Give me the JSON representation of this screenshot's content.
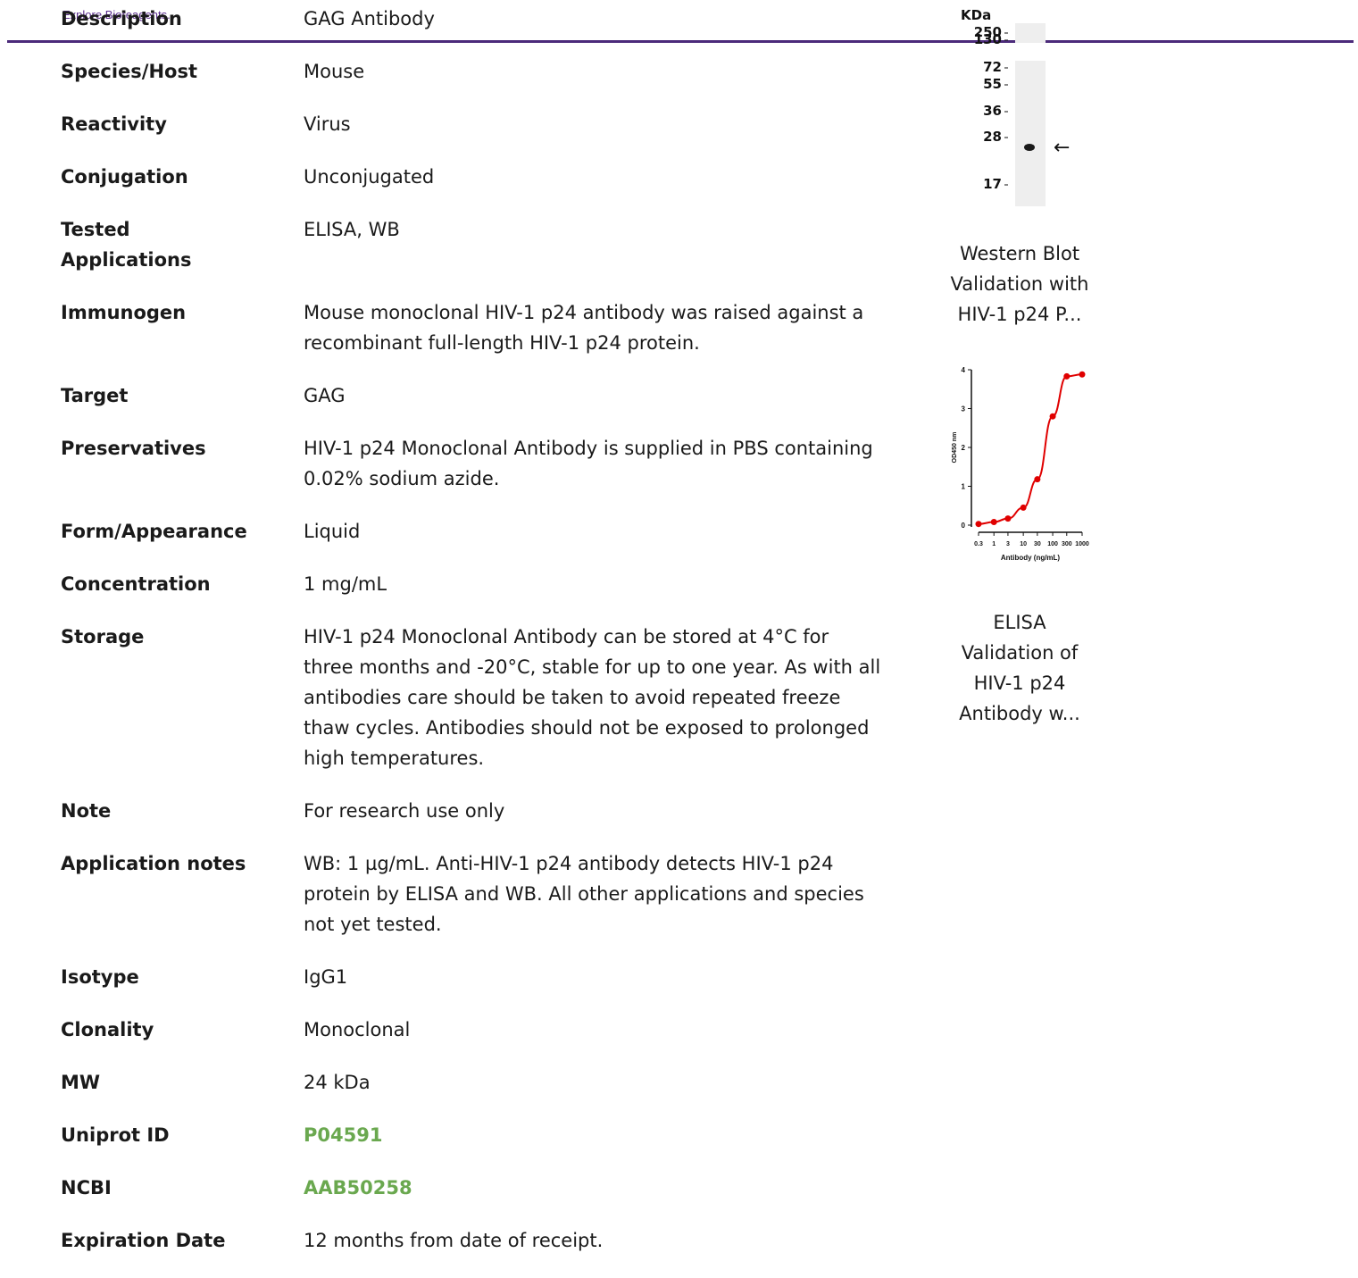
{
  "brand": {
    "text": "Explore Bioreagents.",
    "color": "#5b2d8e"
  },
  "spec": {
    "rows": [
      {
        "label": "Description",
        "value": "GAG Antibody"
      },
      {
        "label": "Species/Host",
        "value": "Mouse"
      },
      {
        "label": "Reactivity",
        "value": "Virus"
      },
      {
        "label": "Conjugation",
        "value": "Unconjugated"
      },
      {
        "label": "Tested Applications",
        "value": "ELISA, WB"
      },
      {
        "label": "Immunogen",
        "value": "Mouse monoclonal HIV-1 p24 antibody was raised against a recombinant full-length HIV-1 p24 protein."
      },
      {
        "label": "Target",
        "value": "GAG"
      },
      {
        "label": "Preservatives",
        "value": "HIV-1 p24 Monoclonal Antibody is supplied in PBS containing 0.02% sodium azide."
      },
      {
        "label": "Form/Appearance",
        "value": "Liquid"
      },
      {
        "label": "Concentration",
        "value": "1 mg/mL"
      },
      {
        "label": "Storage",
        "value": "HIV-1 p24 Monoclonal Antibody can be stored at 4°C for three months and -20°C, stable for up to one year. As with all antibodies care should be taken to avoid repeated freeze thaw cycles. Antibodies should not be exposed to prolonged high temperatures."
      },
      {
        "label": "Note",
        "value": "For research use only"
      },
      {
        "label": "Application notes",
        "value": "WB: 1 µg/mL. Anti-HIV-1 p24 antibody detects HIV-1 p24 protein by ELISA and WB. All other applications and species not yet tested."
      },
      {
        "label": "Isotype",
        "value": "IgG1"
      },
      {
        "label": "Clonality",
        "value": "Monoclonal"
      },
      {
        "label": "MW",
        "value": "24 kDa"
      },
      {
        "label": "Uniprot ID",
        "value": "P04591"
      },
      {
        "label": "NCBI",
        "value": "AAB50258"
      },
      {
        "label": "Expiration Date",
        "value": "12 months from date of receipt."
      }
    ],
    "link_color": "#6aa84f"
  },
  "gallery": {
    "western_blot": {
      "kda_label": "KDa",
      "markers": [
        "250",
        "130",
        "72",
        "55",
        "36",
        "28",
        "17"
      ],
      "arrow": "←",
      "caption": "Western Blot Validation with HIV-1 p24 P..."
    },
    "elisa": {
      "caption": "ELISA Validation of HIV-1 p24 Antibody w..."
    }
  },
  "chart_data": {
    "type": "line",
    "xlabel": "Antibody (ng/mL)",
    "ylabel": "OD450 nm",
    "x_scale": "log",
    "x_ticks": [
      "0.3",
      "1",
      "3",
      "10",
      "30",
      "100",
      "300",
      "1000"
    ],
    "y_ticks": [
      "0",
      "1",
      "2",
      "3",
      "4"
    ],
    "ylim": [
      0,
      4
    ],
    "color": "#e00000",
    "series": [
      {
        "x": [
          0.3,
          1,
          3,
          10,
          30,
          100,
          300,
          1000
        ],
        "values": [
          0.03,
          0.08,
          0.17,
          0.45,
          1.18,
          2.8,
          3.83,
          3.88
        ]
      }
    ]
  }
}
